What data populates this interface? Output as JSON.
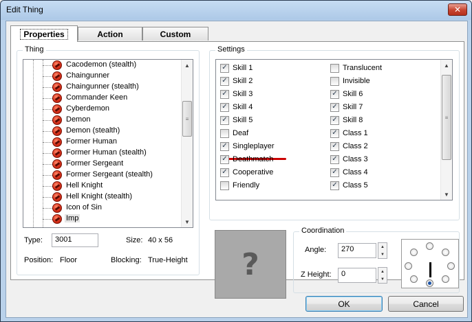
{
  "window": {
    "title": "Edit Thing",
    "close_glyph": "✕"
  },
  "tabs": [
    {
      "label": "Properties",
      "active": true
    },
    {
      "label": "Action",
      "active": false
    },
    {
      "label": "Custom",
      "active": false
    }
  ],
  "thing": {
    "group_label": "Thing",
    "items": [
      "Cacodemon (stealth)",
      "Chaingunner",
      "Chaingunner (stealth)",
      "Commander Keen",
      "Cyberdemon",
      "Demon",
      "Demon (stealth)",
      "Former Human",
      "Former Human (stealth)",
      "Former Sergeant",
      "Former Sergeant (stealth)",
      "Hell Knight",
      "Hell Knight (stealth)",
      "Icon of Sin",
      "Imp"
    ],
    "selected_item": "Imp",
    "icon": "monster-icon",
    "type_label": "Type:",
    "type_value": "3001",
    "size_label": "Size:",
    "size_value": "40 x 56",
    "position_label": "Position:",
    "position_value": "Floor",
    "blocking_label": "Blocking:",
    "blocking_value": "True-Height"
  },
  "settings": {
    "group_label": "Settings",
    "left_column": [
      {
        "label": "Skill 1",
        "checked": true
      },
      {
        "label": "Skill 2",
        "checked": true
      },
      {
        "label": "Skill 3",
        "checked": true
      },
      {
        "label": "Skill 4",
        "checked": true
      },
      {
        "label": "Skill 5",
        "checked": true
      },
      {
        "label": "Deaf",
        "checked": false
      },
      {
        "label": "Singleplayer",
        "checked": true
      },
      {
        "label": "Deathmatch",
        "checked": true
      },
      {
        "label": "Cooperative",
        "checked": true
      },
      {
        "label": "Friendly",
        "checked": false
      }
    ],
    "right_column": [
      {
        "label": "Translucent",
        "checked": false
      },
      {
        "label": "Invisible",
        "checked": false
      },
      {
        "label": "Skill 6",
        "checked": true
      },
      {
        "label": "Skill 7",
        "checked": true
      },
      {
        "label": "Skill 8",
        "checked": true
      },
      {
        "label": "Class 1",
        "checked": true
      },
      {
        "label": "Class 2",
        "checked": true
      },
      {
        "label": "Class 3",
        "checked": true
      },
      {
        "label": "Class 4",
        "checked": true
      },
      {
        "label": "Class 5",
        "checked": true
      }
    ],
    "check_glyph": "✓"
  },
  "preview": {
    "placeholder_glyph": "?"
  },
  "coordination": {
    "group_label": "Coordination",
    "angle_label": "Angle:",
    "angle_value": "270",
    "zheight_label": "Z Height:",
    "zheight_value": "0"
  },
  "buttons": {
    "ok": "OK",
    "cancel": "Cancel"
  },
  "scroll": {
    "up": "▲",
    "down": "▼",
    "grip": "≡"
  },
  "colors": {
    "annotation_underline": "#cc0000",
    "selected_radio": "#1c54a8"
  }
}
